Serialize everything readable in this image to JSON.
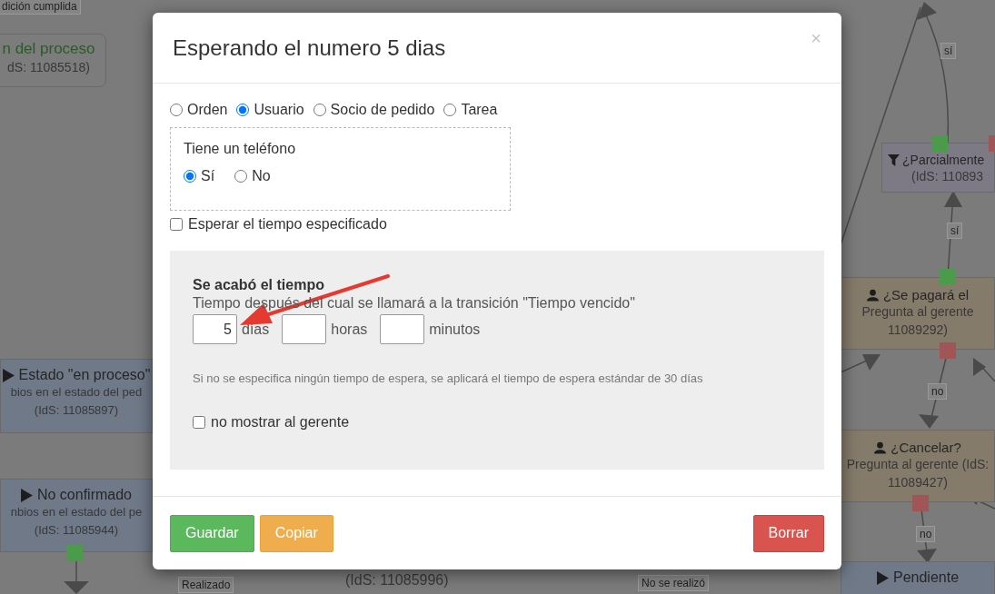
{
  "flowchart": {
    "nodes": [
      {
        "kind": "end",
        "title": "n del proceso",
        "lines": [
          "dS: 11085518)"
        ]
      },
      {
        "kind": "state",
        "title": "Estado \"en proceso\"",
        "lines": [
          "bios en el estado del ped",
          "(IdS: 11085897)"
        ]
      },
      {
        "kind": "state",
        "title": "No confirmado",
        "lines": [
          "nbios en el estado del pe",
          "(IdS: 11085944)"
        ],
        "ports": [
          {
            "color": "#4c9a4c"
          }
        ]
      },
      {
        "kind": "condition",
        "title": "¿Parcialmente",
        "lines": [
          "(IdS: 110893"
        ],
        "ports": [
          {
            "color": "#4c9a4c"
          },
          {
            "color": "#a05656"
          }
        ]
      },
      {
        "kind": "question",
        "title": "¿Se pagará el",
        "lines": [
          "Pregunta al gerente",
          "11089292)"
        ],
        "ports": [
          {
            "color": "#4c9a4c"
          },
          {
            "color": "#a05656"
          }
        ]
      },
      {
        "kind": "question",
        "title": "¿Cancelar?",
        "lines": [
          "Pregunta al gerente (IdS:",
          "11089427)"
        ],
        "ports": [
          {
            "color": "#a05656"
          }
        ]
      },
      {
        "kind": "state",
        "title": "Pendiente"
      },
      {
        "kind": "fragment",
        "title": "(IdS: 11085996)"
      }
    ],
    "edge_labels": [
      {
        "text": "dición cumplida"
      },
      {
        "text": "sí"
      },
      {
        "text": "sí"
      },
      {
        "text": "no"
      },
      {
        "text": "no"
      },
      {
        "text": "No se realizó"
      },
      {
        "text": "Realizado"
      }
    ]
  },
  "dialog": {
    "title": "Esperando el numero 5 dias",
    "close": "×",
    "target_options": [
      {
        "label": "Orden",
        "selected": false
      },
      {
        "label": "Usuario",
        "selected": true
      },
      {
        "label": "Socio de pedido",
        "selected": false
      },
      {
        "label": "Tarea",
        "selected": false
      }
    ],
    "condition": {
      "label": "Tiene un teléfono",
      "options": [
        {
          "label": "Sí",
          "selected": true
        },
        {
          "label": "No",
          "selected": false
        }
      ]
    },
    "wait_checkbox": {
      "label": "Esperar el tiempo especificado",
      "checked": false
    },
    "timeout": {
      "heading": "Se acabó el tiempo",
      "description": "Tiempo después del cual se llamará a la transición \"Tiempo vencido\"",
      "fields": [
        {
          "value": "5",
          "unit": "días"
        },
        {
          "unit": "horas"
        },
        {
          "unit": "minutos"
        }
      ],
      "note": "Si no se especifica ningún tiempo de espera, se aplicará el tiempo de espera estándar de 30 días",
      "hide_checkbox": {
        "label": "no mostrar al gerente",
        "checked": false
      }
    },
    "buttons": [
      {
        "label": "Guardar",
        "kind": "save"
      },
      {
        "label": "Copiar",
        "kind": "copy"
      },
      {
        "label": "Borrar",
        "kind": "delete"
      }
    ]
  }
}
